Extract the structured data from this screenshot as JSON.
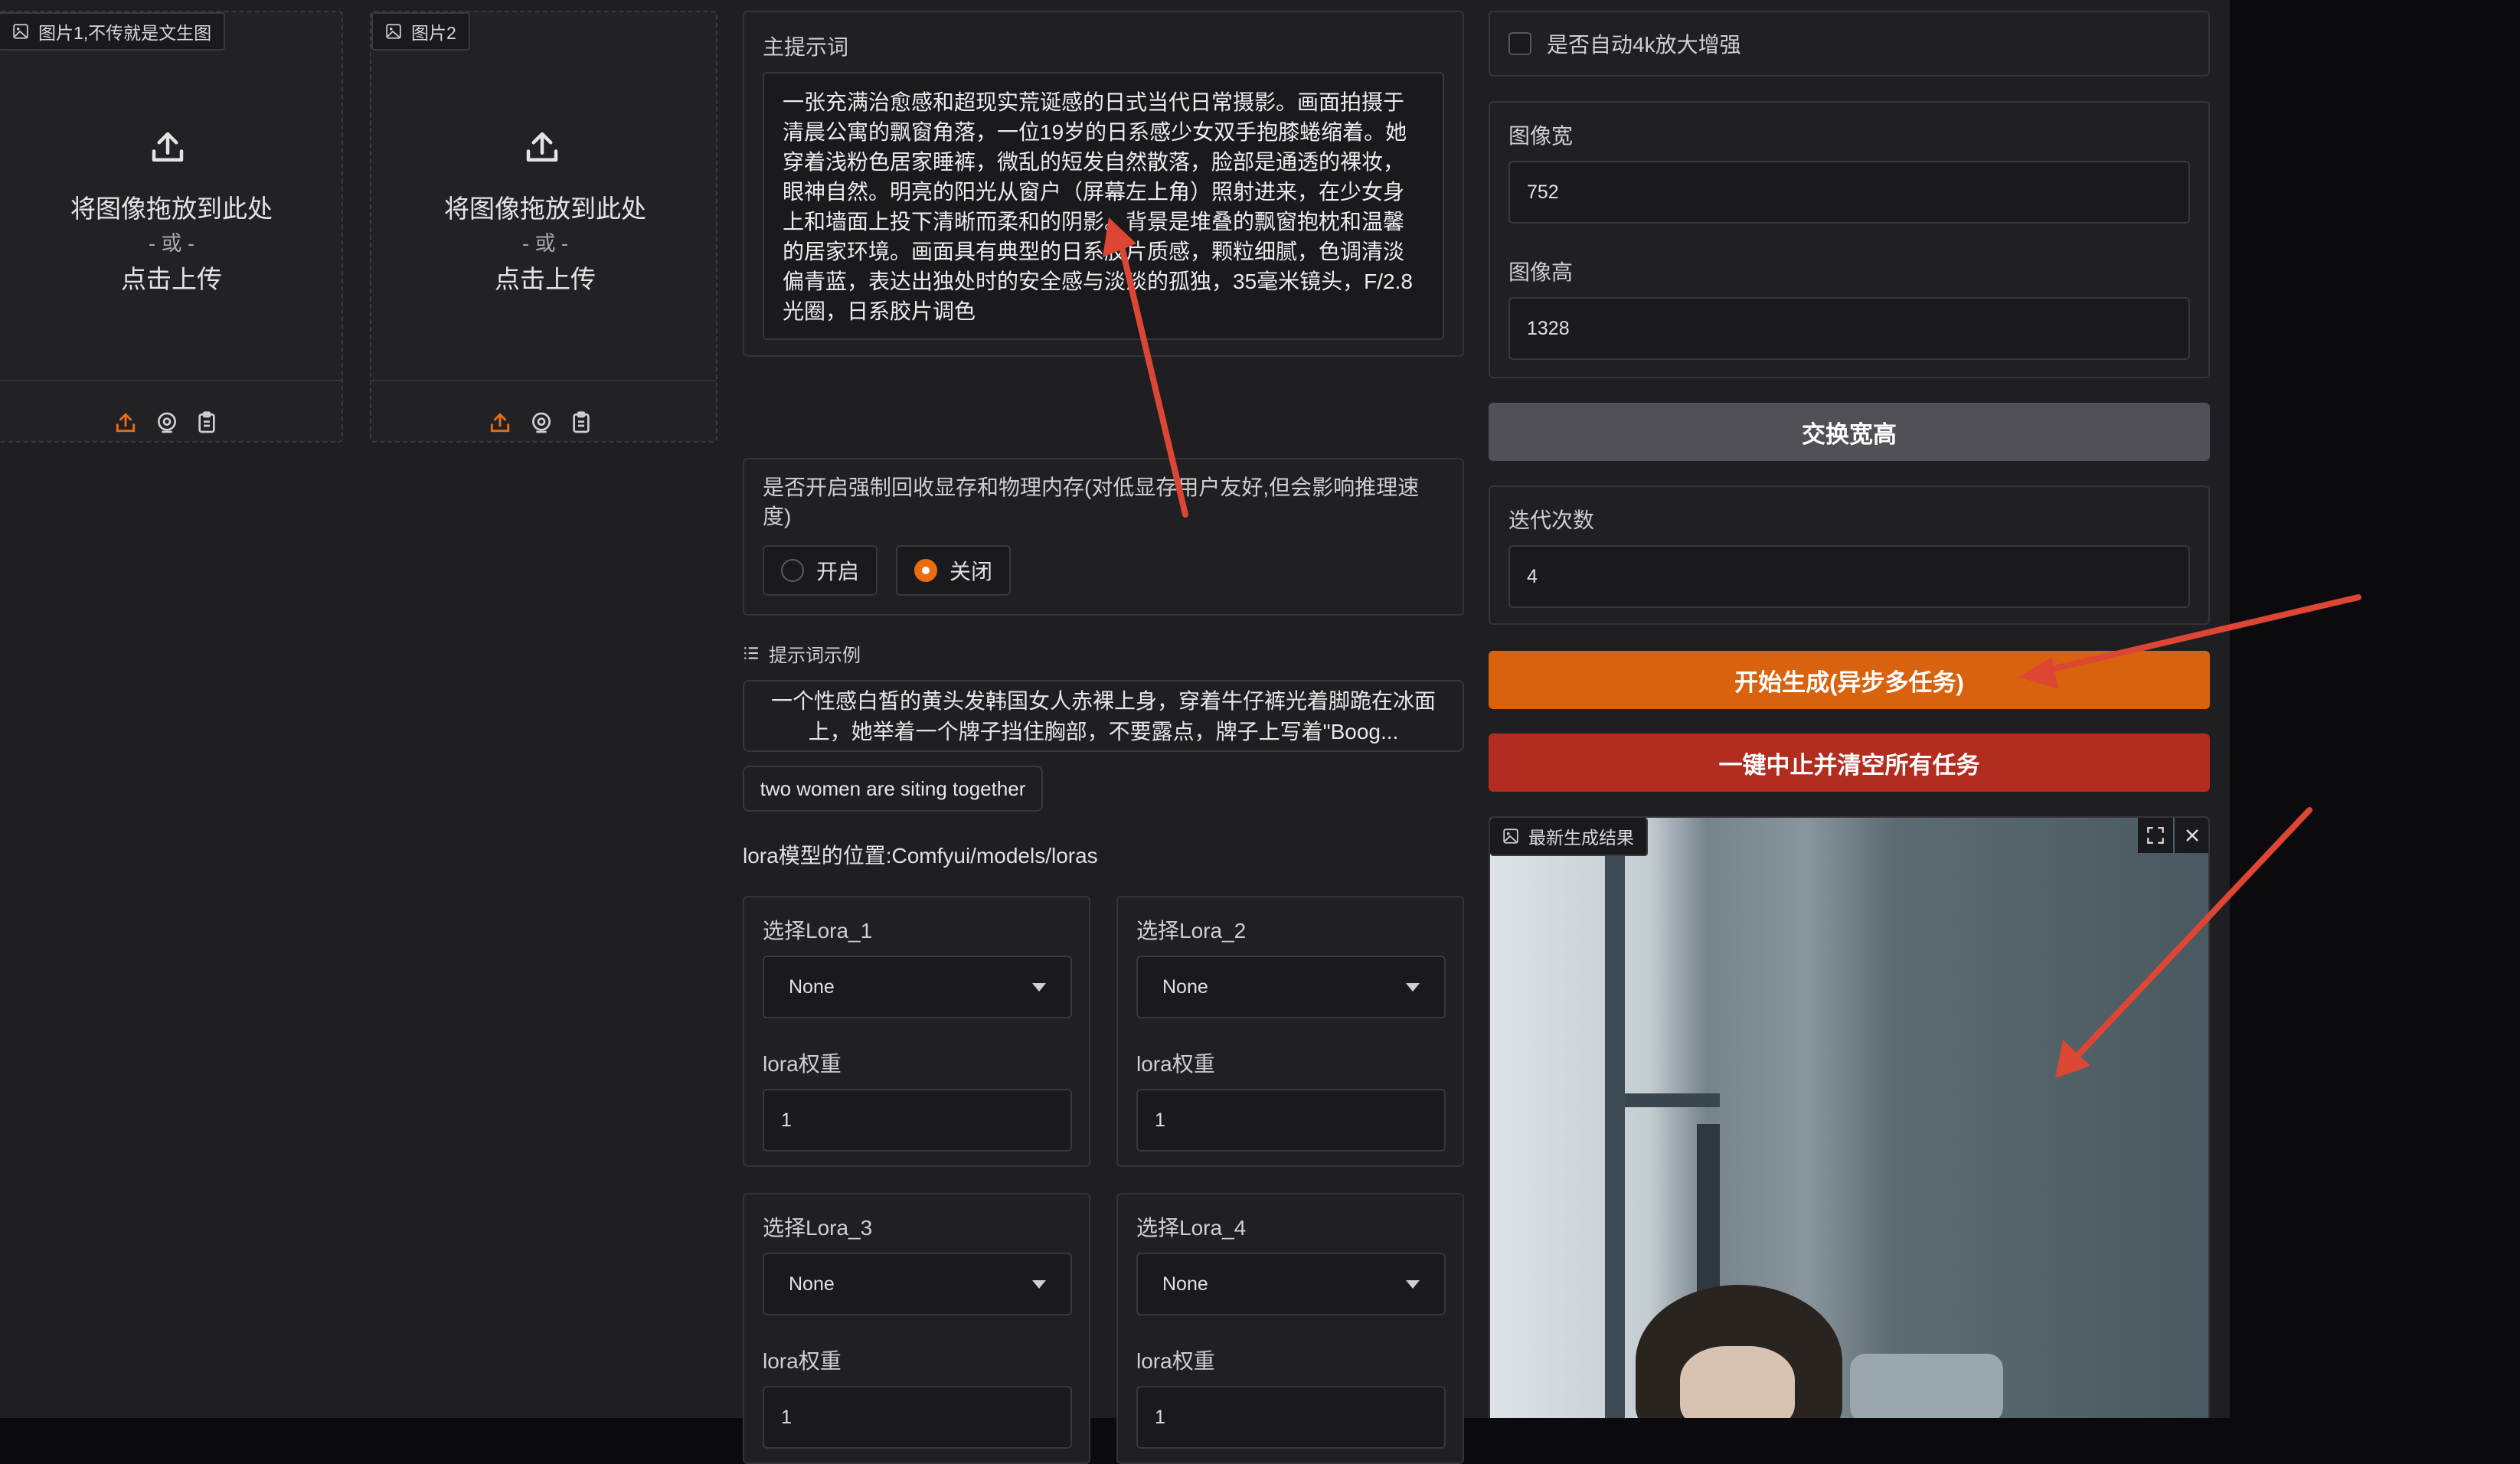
{
  "upload1": {
    "label": "图片1,不传就是文生图",
    "drop_text": "将图像拖放到此处",
    "or_text": "- 或 -",
    "click_text": "点击上传"
  },
  "upload2": {
    "label": "图片2",
    "drop_text": "将图像拖放到此处",
    "or_text": "- 或 -",
    "click_text": "点击上传"
  },
  "prompt": {
    "label": "主提示词",
    "text": "一张充满治愈感和超现实荒诞感的日式当代日常摄影。画面拍摄于清晨公寓的飘窗角落，一位19岁的日系感少女双手抱膝蜷缩着。她穿着浅粉色居家睡裤，微乱的短发自然散落，脸部是通透的裸妆，眼神自然。明亮的阳光从窗户（屏幕左上角）照射进来，在少女身上和墙面上投下清晰而柔和的阴影。背景是堆叠的飘窗抱枕和温馨的居家环境。画面具有典型的日系胶片质感，颗粒细腻，色调清淡偏青蓝，表达出独处时的安全感与淡淡的孤独，35毫米镜头，F/2.8光圈，日系胶片调色"
  },
  "memory": {
    "label": "是否开启强制回收显存和物理内存(对低显存用户友好,但会影响推理速度)",
    "options": [
      "开启",
      "关闭"
    ],
    "selected": "关闭"
  },
  "examples": {
    "title": "提示词示例",
    "items": [
      "一个性感白皙的黄头发韩国女人赤裸上身，穿着牛仔裤光着脚跪在冰面上，她举着一个牌子挡住胸部，不要露点，牌子上写着\"Boog...",
      "two women are siting together"
    ]
  },
  "lora_path": "lora模型的位置:Comfyui/models/loras",
  "loras": [
    {
      "label": "选择Lora_1",
      "value": "None",
      "weight_label": "lora权重",
      "weight": "1"
    },
    {
      "label": "选择Lora_2",
      "value": "None",
      "weight_label": "lora权重",
      "weight": "1"
    },
    {
      "label": "选择Lora_3",
      "value": "None",
      "weight_label": "lora权重",
      "weight": "1"
    },
    {
      "label": "选择Lora_4",
      "value": "None",
      "weight_label": "lora权重",
      "weight": "1"
    }
  ],
  "upscale": {
    "label": "是否自动4k放大增强",
    "checked": false
  },
  "size": {
    "width_label": "图像宽",
    "width": "752",
    "height_label": "图像高",
    "height": "1328",
    "swap_label": "交换宽高"
  },
  "iterations": {
    "label": "迭代次数",
    "value": "4"
  },
  "buttons": {
    "generate": "开始生成(异步多任务)",
    "stop": "一键中止并清空所有任务"
  },
  "result": {
    "label": "最新生成结果"
  },
  "colors": {
    "generate": "#d9620f",
    "stop": "#b22c1f",
    "swap": "#505056",
    "arrow": "#dd4633",
    "accent": "#ea6d10"
  }
}
